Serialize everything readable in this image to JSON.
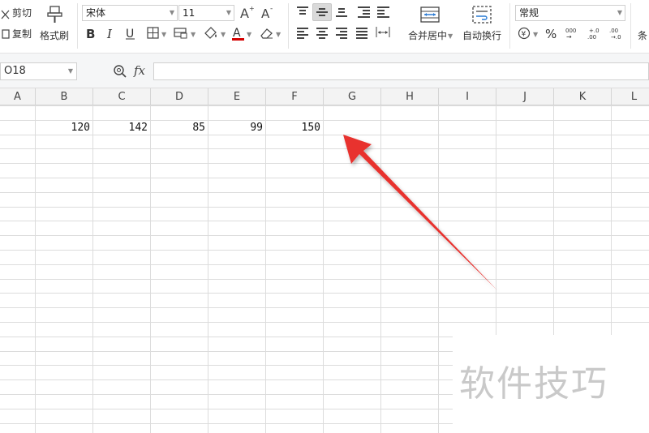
{
  "ribbon": {
    "cut_label": "剪切",
    "copy_label": "复制",
    "format_painter_label": "格式刷",
    "font_name": "宋体",
    "font_size": "11",
    "merge_center_label": "合并居中",
    "auto_wrap_label": "自动换行",
    "number_format": "常规",
    "truncated_label": "条"
  },
  "formula_bar": {
    "name_box": "O18",
    "fx_label": "fx",
    "formula_value": ""
  },
  "sheet": {
    "columns": [
      "A",
      "B",
      "C",
      "D",
      "E",
      "F",
      "G",
      "H",
      "I",
      "J",
      "K",
      "L"
    ],
    "row1_values": [
      "120",
      "142",
      "85",
      "99",
      "150"
    ]
  },
  "watermark": "软件技巧",
  "colors": {
    "arrow": "#e8322f",
    "grid_line": "#dcdcdc",
    "selected_button": "#d9d9d9",
    "font_color_underline": "#d40000"
  },
  "icons": [
    "scissors-icon",
    "copy-icon",
    "format-painter-icon",
    "bold-icon",
    "italic-icon",
    "underline-icon",
    "border-icon",
    "fill-color-icon",
    "font-color-icon",
    "clear-icon",
    "increase-font-icon",
    "decrease-font-icon",
    "align-top-icon",
    "align-middle-icon",
    "align-bottom-icon",
    "decrease-indent-icon",
    "increase-indent-icon",
    "align-left-icon",
    "align-center-icon",
    "align-right-icon",
    "justify-icon",
    "distribute-icon",
    "merge-center-icon",
    "wrap-text-icon",
    "currency-icon",
    "percent-icon",
    "thousands-icon",
    "increase-decimal-icon",
    "decrease-decimal-icon",
    "zoom-icon"
  ]
}
